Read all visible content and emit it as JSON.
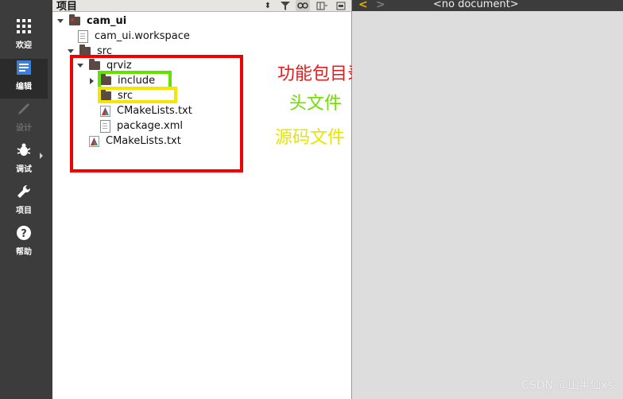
{
  "modebar": {
    "items": [
      {
        "label": "欢迎",
        "icon": "grid-icon"
      },
      {
        "label": "编辑",
        "icon": "document-edit-icon"
      },
      {
        "label": "设计",
        "icon": "pen-icon"
      },
      {
        "label": "调试",
        "icon": "bug-icon"
      },
      {
        "label": "项目",
        "icon": "wrench-icon"
      },
      {
        "label": "帮助",
        "icon": "help-icon"
      }
    ]
  },
  "project_pane": {
    "title": "项目",
    "toolbar": [
      "updown-icon",
      "filter-icon",
      "link-icon",
      "split-icon",
      "close-pane-icon"
    ],
    "tree": {
      "project": "cam_ui",
      "workspace": "cam_ui.workspace",
      "src": "src",
      "package": "qrviz",
      "include": "include",
      "sub_src": "src",
      "pkg_cmake": "CMakeLists.txt",
      "package_xml": "package.xml",
      "src_cmake": "CMakeLists.txt"
    }
  },
  "annotations": {
    "package_dir": "功能包目录",
    "headers": "头文件",
    "sources": "源码文件"
  },
  "editor": {
    "doc_title": "<no document>"
  },
  "watermark": "CSDN @山半仙xs",
  "colors": {
    "red_box": "#f20000",
    "green_box": "#66e000",
    "yellow_box": "#f3e600"
  }
}
